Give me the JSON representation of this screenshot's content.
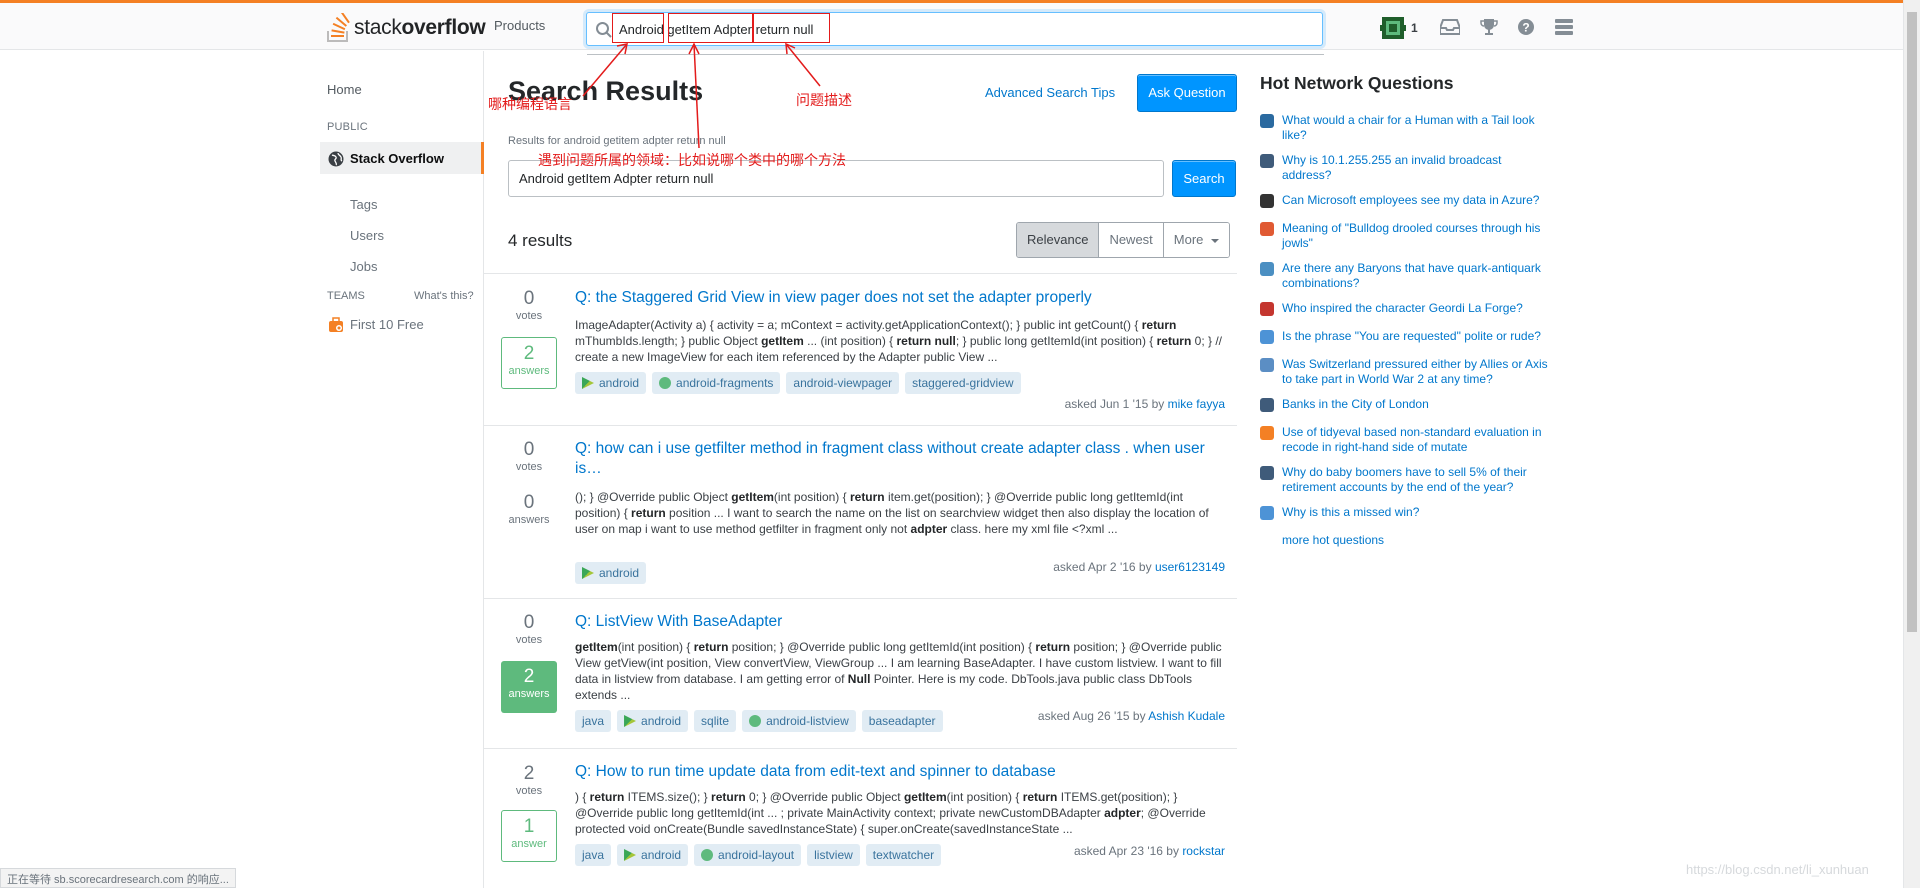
{
  "topbar": {
    "logo_prefix": "stack",
    "logo_bold": "overflow",
    "products": "Products",
    "search_value": "Android getItem Adpter return null",
    "reputation": "1"
  },
  "leftnav": {
    "home": "Home",
    "public": "PUBLIC",
    "stack_overflow": "Stack Overflow",
    "tags": "Tags",
    "users": "Users",
    "jobs": "Jobs",
    "teams": "TEAMS",
    "whats_this": "What's this?",
    "first_free": "First 10 Free"
  },
  "main": {
    "title": "Search Results",
    "advanced_tips": "Advanced Search Tips",
    "ask_question": "Ask Question",
    "results_for": "Results for android getitem adpter return null",
    "search_value": "Android getItem Adpter return null",
    "search_button": "Search",
    "count": "4 results",
    "sorts": [
      "Relevance",
      "Newest",
      "More"
    ]
  },
  "questions": [
    {
      "votes": "0",
      "votes_label": "votes",
      "answers": "2",
      "answers_label": "answers",
      "answer_state": "ok",
      "title": "Q: the Staggered Grid View in view pager does not set the adapter properly",
      "asked": "asked Jun 1 '15 by",
      "user": "mike fayya",
      "tags": [
        "android",
        "android-fragments",
        "android-viewpager",
        "staggered-gridview"
      ]
    },
    {
      "votes": "0",
      "votes_label": "votes",
      "answers": "0",
      "answers_label": "answers",
      "answer_state": "none",
      "title": "Q: how can i use getfilter method in fragment class without create adapter class . when user is…",
      "asked": "asked Apr 2 '16 by",
      "user": "user6123149",
      "tags": [
        "android"
      ]
    },
    {
      "votes": "0",
      "votes_label": "votes",
      "answers": "2",
      "answers_label": "answers",
      "answer_state": "accepted",
      "title": "Q: ListView With BaseAdapter",
      "asked": "asked Aug 26 '15 by",
      "user": "Ashish Kudale",
      "tags": [
        "java",
        "android",
        "sqlite",
        "android-listview",
        "baseadapter"
      ]
    },
    {
      "votes": "2",
      "votes_label": "votes",
      "answers": "1",
      "answers_label": "answer",
      "answer_state": "ok",
      "title": "Q: How to run time update data from edit-text and spinner to database",
      "asked": "asked Apr 23 '16 by",
      "user": "rockstar",
      "tags": [
        "java",
        "android",
        "android-layout",
        "listview",
        "textwatcher"
      ]
    }
  ],
  "hot_network": {
    "title": "Hot Network Questions",
    "items": [
      {
        "text": "What would a chair for a Human with a Tail look like?",
        "icon": "worldbuilding-icon",
        "color": "#2b6aa0"
      },
      {
        "text": "Why is 10.1.255.255 an invalid broadcast address?",
        "icon": "network-engineering-icon",
        "color": "#3f5b7a"
      },
      {
        "text": "Can Microsoft employees see my data in Azure?",
        "icon": "security-icon",
        "color": "#333333"
      },
      {
        "text": "Meaning of \"Bulldog drooled courses through his jowls\"",
        "icon": "english-icon",
        "color": "#e05a33"
      },
      {
        "text": "Are there any Baryons that have quark-antiquark combinations?",
        "icon": "physics-icon",
        "color": "#4b8fc2"
      },
      {
        "text": "Who inspired the character Geordi La Forge?",
        "icon": "scifi-icon",
        "color": "#c4362f"
      },
      {
        "text": "Is the phrase \"You are requested\" polite or rude?",
        "icon": "ell-icon",
        "color": "#4d93d6"
      },
      {
        "text": "Was Switzerland pressured either by Allies or Axis to take part in World War 2 at any time?",
        "icon": "history-icon",
        "color": "#5b8ec4"
      },
      {
        "text": "Banks in the City of London",
        "icon": "travel-icon",
        "color": "#3f5b7a"
      },
      {
        "text": "Use of tidyeval based non-standard evaluation in recode in right-hand side of mutate",
        "icon": "stackoverflow-icon",
        "color": "#f48024"
      },
      {
        "text": "Why do baby boomers have to sell 5% of their retirement accounts by the end of the year?",
        "icon": "money-icon",
        "color": "#3f5b7a"
      },
      {
        "text": "Why is this a missed win?",
        "icon": "chess-icon",
        "color": "#4d93d6"
      }
    ],
    "more": "more hot questions"
  },
  "annotations": {
    "language": "哪种编程语言",
    "problem": "问题描述",
    "domain": "遇到问题所属的领域：比如说哪个类中的哪个方法"
  },
  "status_text": "正在等待 sb.scorecardresearch.com 的响应...",
  "watermark": "https://blog.csdn.net/li_xunhuan"
}
